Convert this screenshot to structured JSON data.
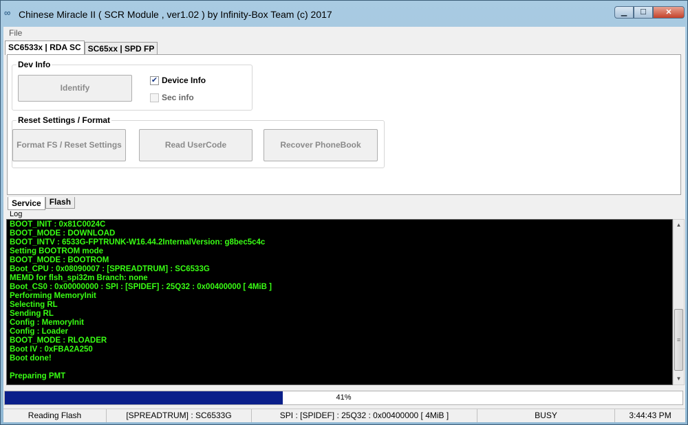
{
  "window": {
    "title": "Chinese Miracle II ( SCR Module , ver1.02  ) by Infinity-Box Team (c) 2017",
    "app_icon": "infinity-icon",
    "controls": {
      "minimize": "▁",
      "maximize": "☐",
      "close": "✕"
    }
  },
  "menu": {
    "file": "File"
  },
  "top_tabs": [
    {
      "label": "SC6533x | RDA SC",
      "active": true
    },
    {
      "label": "SC65xx | SPD FP",
      "active": false
    }
  ],
  "dev_info": {
    "title": "Dev Info",
    "identify_label": "Identify",
    "device_info_label": "Device Info",
    "device_info_checked": true,
    "sec_info_label": "Sec info",
    "sec_info_checked": false
  },
  "reset": {
    "title": "Reset Settings / Format",
    "format_label": "Format FS / Reset Settings",
    "read_usercode_label": "Read UserCode",
    "recover_phonebook_label": "Recover PhoneBook"
  },
  "bottom_tabs": [
    {
      "label": "Service",
      "active": true
    },
    {
      "label": "Flash",
      "active": false
    }
  ],
  "log": {
    "label": "Log",
    "lines": [
      "BOOT_INIT : 0x81C0024C",
      "BOOT_MODE : DOWNLOAD",
      "BOOT_INTV : 6533G-FPTRUNK-W16.44.2InternalVersion: g8bec5c4c",
      "Setting BOOTROM mode",
      "BOOT_MODE : BOOTROM",
      "Boot_CPU  : 0x08090007 : [SPREADTRUM] : SC6533G",
      "MEMD for flsh_spi32m Branch: none",
      "Boot_CS0 : 0x00000000 : SPI : [SPIDEF] : 25Q32 : 0x00400000 [ 4MiB ]",
      "Performing MemoryInit",
      "Selecting RL",
      "Sending RL",
      "Config : MemoryInit",
      "Config : Loader",
      "BOOT_MODE : RLOADER",
      "Boot IV  : 0xFBA2A250",
      "Boot done!",
      "",
      "Preparing PMT"
    ],
    "text_color": "#39ff14"
  },
  "progress": {
    "text": "41%",
    "fraction": 0.41,
    "color": "#0a1f8a"
  },
  "status": {
    "task": "Reading Flash",
    "cpu": "[SPREADTRUM] : SC6533G",
    "flash": "SPI : [SPIDEF] : 25Q32 : 0x00400000 [ 4MiB ]",
    "state": "BUSY",
    "time": "3:44:43 PM"
  }
}
